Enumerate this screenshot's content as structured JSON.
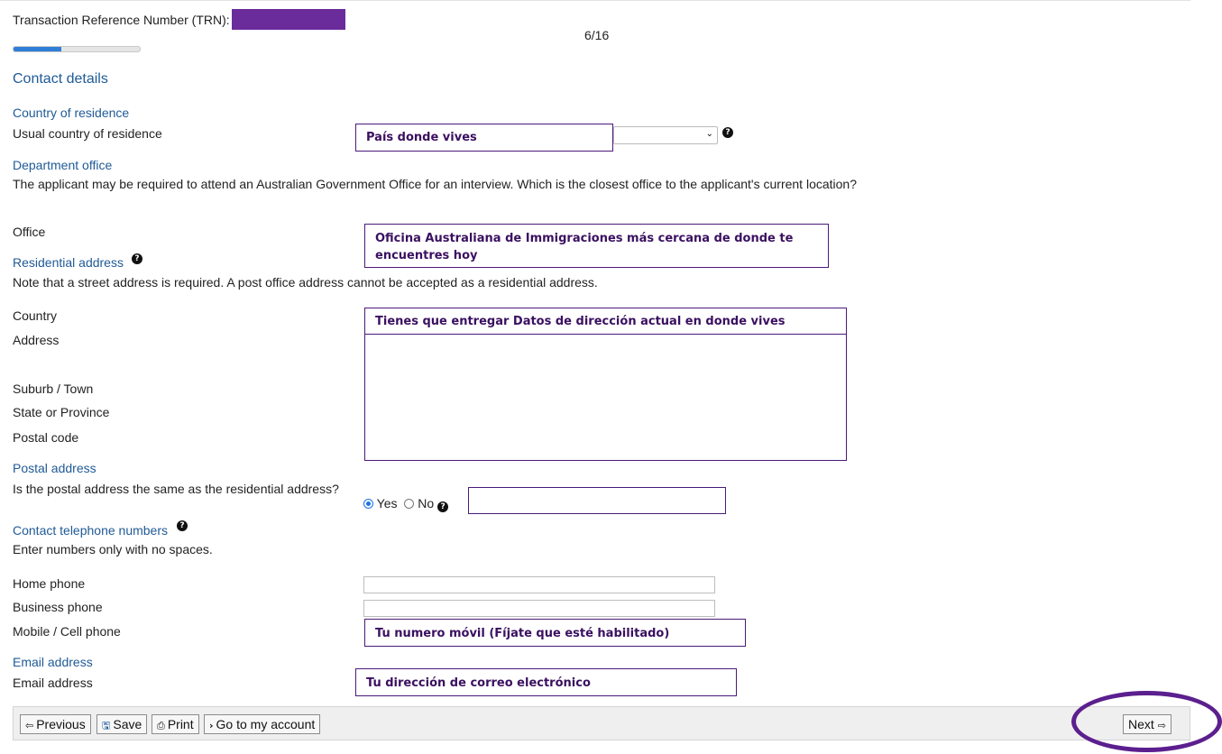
{
  "header": {
    "trn_label": "Transaction Reference Number (TRN):",
    "page_counter": "6/16",
    "progress": 0.375
  },
  "section_title": "Contact details",
  "country_of_residence": {
    "heading": "Country of residence",
    "label": "Usual country of residence",
    "annotation": "País donde vives",
    "selected_value": ""
  },
  "department_office": {
    "heading": "Department office",
    "description": "The applicant may be required to attend an Australian Government Office for an interview. Which is the closest office to the applicant's current location?",
    "office_label": "Office",
    "annotation": "Oficina Australiana de Immigraciones  más cercana de donde te encuentres hoy"
  },
  "residential_address": {
    "heading": "Residential address",
    "note": "Note that a street address is required. A post office address cannot be accepted as a residential address.",
    "country_label": "Country",
    "address_label": "Address",
    "suburb_label": "Suburb / Town",
    "state_label": "State or Province",
    "postal_label": "Postal code",
    "annotation": "Tienes que entregar Datos de dirección actual en donde vives"
  },
  "postal_address": {
    "heading": "Postal address",
    "question": "Is the postal address the same as the residential address?",
    "yes_label": "Yes",
    "no_label": "No",
    "selected": "Yes"
  },
  "contact_phones": {
    "heading": "Contact telephone numbers",
    "note": "Enter numbers only with no spaces.",
    "home_label": "Home phone",
    "business_label": "Business phone",
    "mobile_label": "Mobile / Cell phone",
    "mobile_annotation": "Tu numero móvil (Fíjate que esté habilitado)"
  },
  "email": {
    "heading": "Email address",
    "label": "Email address",
    "annotation": "Tu dirección de correo electrónico"
  },
  "footer": {
    "previous_label": "Previous",
    "save_label": "Save",
    "print_label": "Print",
    "account_label": "Go to my account",
    "next_label": "Next"
  },
  "colors": {
    "heading": "#1f5a96",
    "annotation_border": "#4b1a7a",
    "trn_mask": "#6a2b9b",
    "progress_fill": "#2f7fd8",
    "next_ring": "#5b1f8e"
  },
  "icons": {
    "help": "question-circle-icon",
    "previous": "arrow-left-outline-icon",
    "save": "floppy-disk-icon",
    "print": "printer-icon",
    "account": "chevron-right-icon",
    "next": "arrow-right-outline-icon"
  }
}
